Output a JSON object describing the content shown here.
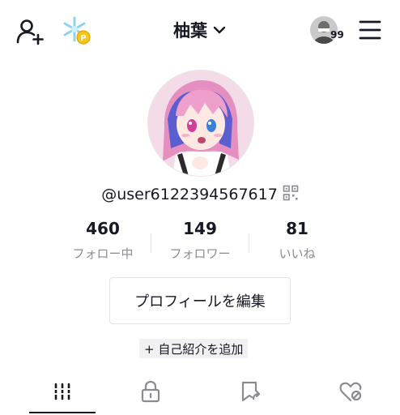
{
  "header": {
    "title": "柚葉",
    "notification_count": "99",
    "icons": [
      "add-user-icon",
      "snowflake-coin-icon",
      "chevron-down-icon",
      "avatar-thumbnail",
      "menu-icon"
    ]
  },
  "profile": {
    "username": "@user6122394567617",
    "avatar_desc": "anime-avatar"
  },
  "stats": [
    {
      "value": "460",
      "label": "フォロー中"
    },
    {
      "value": "149",
      "label": "フォロワー"
    },
    {
      "value": "81",
      "label": "いいね"
    }
  ],
  "actions": {
    "edit_profile": "プロフィールを編集",
    "add_bio": "+ 自己紹介を追加"
  },
  "tabs": [
    {
      "icon": "videos-grid-icon",
      "active": true
    },
    {
      "icon": "lock-icon",
      "active": false
    },
    {
      "icon": "bookmark-icon",
      "active": false
    },
    {
      "icon": "liked-heart-icon",
      "active": false
    }
  ],
  "colors": {
    "text": "#161823",
    "secondary": "#8a8b91",
    "divider": "#e3e3e4",
    "coin": "#f5c518",
    "snow": "#8fd3f4"
  }
}
